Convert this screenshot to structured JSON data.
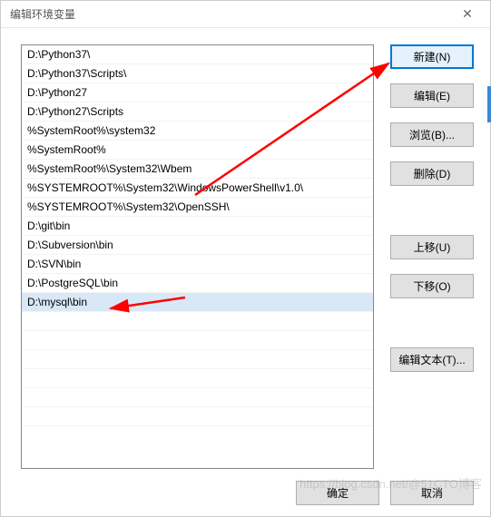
{
  "window": {
    "title": "编辑环境变量",
    "close_glyph": "✕"
  },
  "path_entries": [
    "D:\\Python37\\",
    "D:\\Python37\\Scripts\\",
    "D:\\Python27",
    "D:\\Python27\\Scripts",
    "%SystemRoot%\\system32",
    "%SystemRoot%",
    "%SystemRoot%\\System32\\Wbem",
    "%SYSTEMROOT%\\System32\\WindowsPowerShell\\v1.0\\",
    "%SYSTEMROOT%\\System32\\OpenSSH\\",
    "D:\\git\\bin",
    "D:\\Subversion\\bin",
    "D:\\SVN\\bin",
    "D:\\PostgreSQL\\bin",
    "D:\\mysql\\bin"
  ],
  "selected_index": 13,
  "buttons": {
    "new": "新建(N)",
    "edit": "编辑(E)",
    "browse": "浏览(B)...",
    "delete": "删除(D)",
    "move_up": "上移(U)",
    "move_down": "下移(O)",
    "edit_text": "编辑文本(T)...",
    "ok": "确定",
    "cancel": "取消"
  },
  "watermark": "https://blog.csdn.net/@51CTO博客",
  "annotations": {
    "arrow1": {
      "from_entry_index": 7,
      "to_button": "new",
      "color": "#ff0000"
    },
    "arrow2": {
      "from_entry_index": 13,
      "color": "#ff0000"
    }
  }
}
